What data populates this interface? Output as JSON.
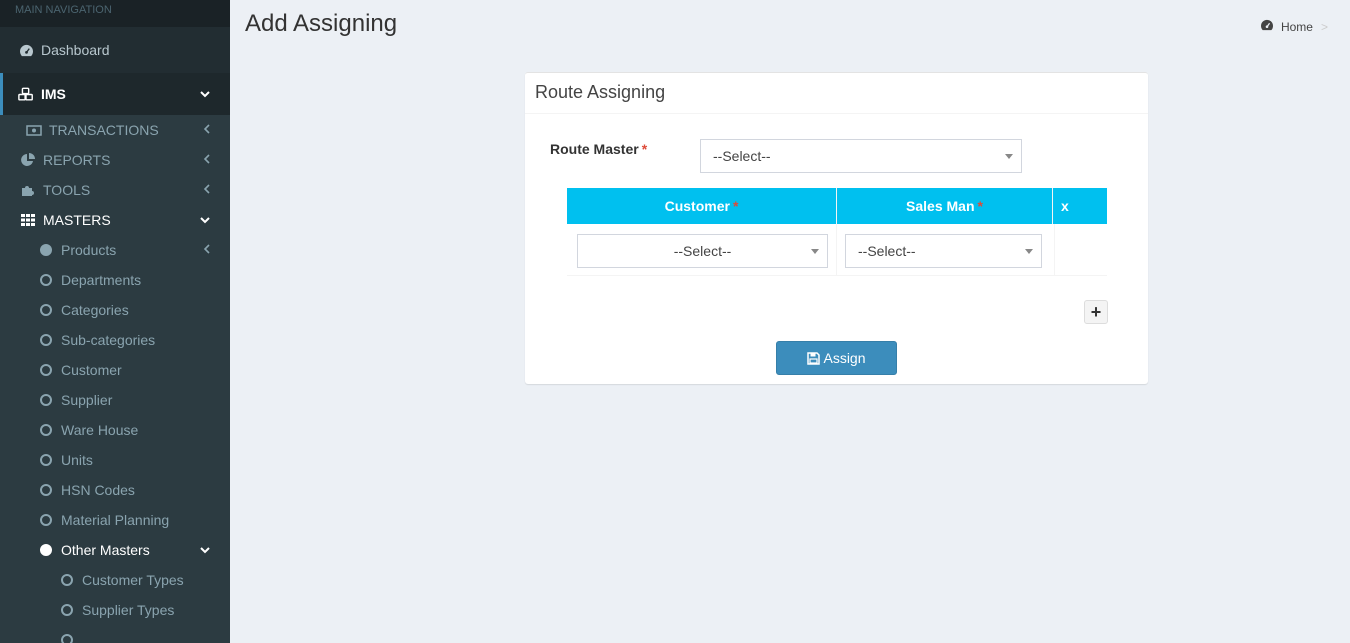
{
  "sidebar": {
    "header": "MAIN NAVIGATION",
    "dashboard": "Dashboard",
    "ims": "IMS",
    "transactions": "TRANSACTIONS",
    "reports": "REPORTS",
    "tools": "TOOLS",
    "masters": "MASTERS",
    "items": [
      {
        "label": "Products"
      },
      {
        "label": "Departments"
      },
      {
        "label": "Categories"
      },
      {
        "label": "Sub-categories"
      },
      {
        "label": "Customer"
      },
      {
        "label": "Supplier"
      },
      {
        "label": "Ware House"
      },
      {
        "label": "Units"
      },
      {
        "label": "HSN Codes"
      },
      {
        "label": "Material Planning"
      },
      {
        "label": "Other Masters"
      }
    ],
    "sub_items": [
      {
        "label": "Customer Types"
      },
      {
        "label": "Supplier Types"
      }
    ]
  },
  "header": {
    "title": "Add Assigning",
    "breadcrumb_home": "Home",
    "breadcrumb_sep": ">"
  },
  "form": {
    "box_title": "Route Assigning",
    "route_master_label": "Route Master",
    "required_mark": "*",
    "route_master_value": "--Select--",
    "columns": {
      "customer": "Customer",
      "sales_man": "Sales Man",
      "x": "x"
    },
    "row": {
      "customer_value": "--Select--",
      "sales_man_value": "--Select--"
    },
    "add_label": "+",
    "assign_label": "Assign"
  },
  "colors": {
    "sidebar_bg": "#222d32",
    "accent": "#3c8dbc",
    "table_header": "#00c0ef",
    "required": "#dd4b39"
  }
}
